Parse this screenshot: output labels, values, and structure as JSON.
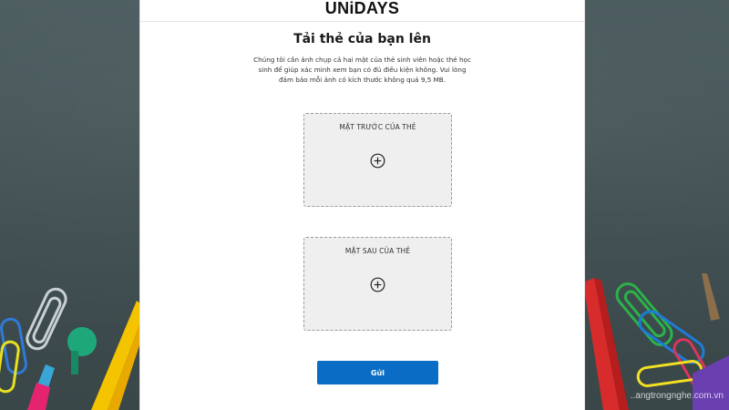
{
  "header": {
    "logo_text": "UNiDAYS"
  },
  "main": {
    "title": "Tải thẻ của bạn lên",
    "description": "Chúng tôi cần ảnh chụp cả hai mặt của thẻ sinh viên hoặc thẻ học sinh để giúp xác minh xem bạn có đủ điều kiện không. Vui lòng đảm bảo mỗi ảnh có kích thước không quá 9,5 MB.",
    "front_card_label": "MẶT TRƯỚC CỦA THẺ",
    "back_card_label": "MẶT SAU CỦA THẺ",
    "submit_label": "Gửi"
  },
  "watermark": "..angtrongnghe.com.vn",
  "colors": {
    "accent": "#0a6cc4",
    "upload_bg": "#efeff0",
    "background": "#3f4f52"
  },
  "icons": {
    "upload_front": "plus-circle-icon",
    "upload_back": "plus-circle-icon"
  }
}
